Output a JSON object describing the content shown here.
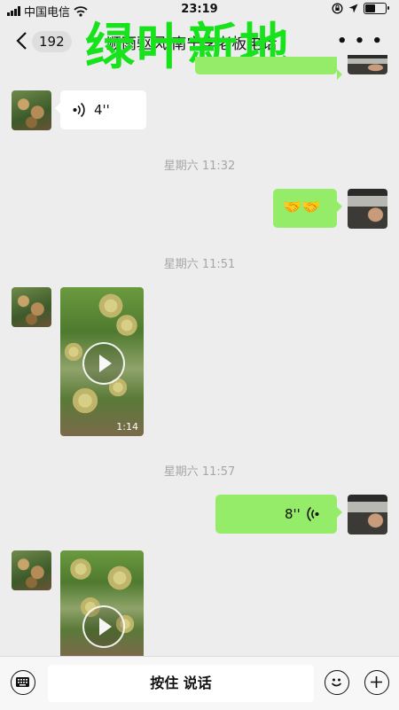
{
  "status_bar": {
    "carrier": "中国电信",
    "time": "23:19"
  },
  "header": {
    "unread_count": "192",
    "title": "顺雨驱风 南宁李老板电话",
    "watermark": "绿叶新地"
  },
  "messages": {
    "voice_in": {
      "duration": "4''"
    },
    "stamp_1": "星期六 11:32",
    "emoji_out": "🤝🤝",
    "stamp_2": "星期六 11:51",
    "video_1": {
      "duration": "1:14"
    },
    "stamp_3": "星期六 11:57",
    "voice_out": {
      "duration": "8''"
    }
  },
  "input_bar": {
    "hold_to_talk": "按住 说话"
  },
  "colors": {
    "bubble_outgoing": "#95ec69",
    "bubble_incoming": "#ffffff",
    "watermark": "#18e21c",
    "background": "#ededed"
  }
}
